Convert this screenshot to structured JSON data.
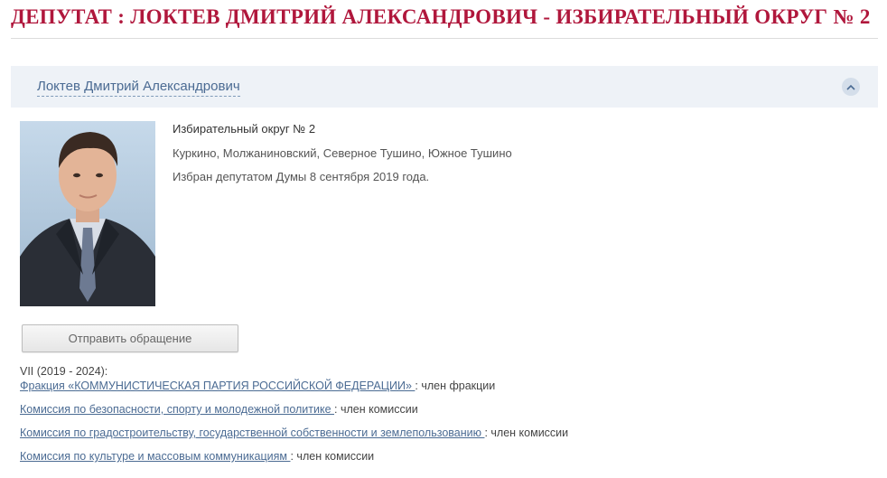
{
  "page": {
    "title": "ДЕПУТАТ : ЛОКТЕВ ДМИТРИЙ АЛЕКСАНДРОВИЧ - ИЗБИРАТЕЛЬНЫЙ ОКРУГ № 2"
  },
  "accordion": {
    "name_link": "Локтев Дмитрий Александрович",
    "toggle_icon": "chevron-up-icon"
  },
  "info": {
    "district": "Избирательный округ № 2",
    "areas": "Куркино, Молжаниновский, Северное Тушино, Южное Тушино",
    "elected": "Избран депутатом Думы 8 сентября 2019 года."
  },
  "actions": {
    "send_appeal_label": "Отправить обращение"
  },
  "convocation": {
    "label": "VII (2019 - 2024):",
    "memberships": [
      {
        "link": "Фракция «КОММУНИСТИЧЕСКАЯ ПАРТИЯ РОССИЙСКОЙ ФЕДЕРАЦИИ» ",
        "role": ": член фракции"
      },
      {
        "link": "Комиссия по безопасности, спорту и молодежной политике ",
        "role": ": член комиссии"
      },
      {
        "link": "Комиссия по градостроительству, государственной собственности и землепользованию ",
        "role": ": член комиссии"
      },
      {
        "link": "Комиссия по культуре и массовым коммуникациям ",
        "role": ": член комиссии"
      }
    ]
  },
  "colors": {
    "title": "#b0173c",
    "link": "#4b6b93",
    "header_bg": "#eef2f7"
  }
}
